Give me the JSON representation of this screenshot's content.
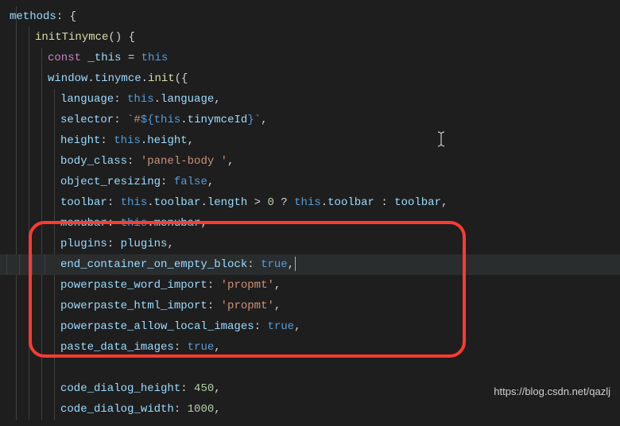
{
  "code": {
    "l1_a": "methods",
    "l1_b": ": {",
    "l2_a": "initTinymce",
    "l2_b": "() {",
    "l3_a": "const",
    "l3_b": " _this ",
    "l3_c": "=",
    "l3_d": " this",
    "l4_a": "window",
    "l4_b": ".",
    "l4_c": "tinymce",
    "l4_d": ".",
    "l4_e": "init",
    "l4_f": "({",
    "l5_k": "language",
    "l5_a": ": ",
    "l5_b": "this",
    "l5_c": ".",
    "l5_d": "language",
    "l5_e": ",",
    "l6_k": "selector",
    "l6_a": ": ",
    "l6_b": "`#",
    "l6_c": "${",
    "l6_d": "this",
    "l6_e": ".",
    "l6_f": "tinymceId",
    "l6_g": "}",
    "l6_h": "`",
    "l6_i": ",",
    "l7_k": "height",
    "l7_a": ": ",
    "l7_b": "this",
    "l7_c": ".",
    "l7_d": "height",
    "l7_e": ",",
    "l8_k": "body_class",
    "l8_a": ": ",
    "l8_b": "'panel-body '",
    "l8_c": ",",
    "l9_k": "object_resizing",
    "l9_a": ": ",
    "l9_b": "false",
    "l9_c": ",",
    "l10_k": "toolbar",
    "l10_a": ": ",
    "l10_b": "this",
    "l10_c": ".",
    "l10_d": "toolbar",
    "l10_e": ".",
    "l10_f": "length",
    "l10_g": " > ",
    "l10_h": "0",
    "l10_i": " ? ",
    "l10_j": "this",
    "l10_k2": ".",
    "l10_l": "toolbar",
    "l10_m": " : ",
    "l10_n": "toolbar",
    "l10_o": ",",
    "l11_k": "menubar",
    "l11_a": ": ",
    "l11_b": "this",
    "l11_c": ".",
    "l11_d": "menubar",
    "l11_e": ",",
    "l12_k": "plugins",
    "l12_a": ": ",
    "l12_b": "plugins",
    "l12_c": ",",
    "l13_k": "end_container_on_empty_block",
    "l13_a": ": ",
    "l13_b": "true",
    "l13_c": ",",
    "l14_k": "powerpaste_word_import",
    "l14_a": ": ",
    "l14_b": "'propmt'",
    "l14_c": ",",
    "l15_k": "powerpaste_html_import",
    "l15_a": ": ",
    "l15_b": "'propmt'",
    "l15_c": ",",
    "l16_k": "powerpaste_allow_local_images",
    "l16_a": ": ",
    "l16_b": "true",
    "l16_c": ",",
    "l17_k": "paste_data_images",
    "l17_a": ": ",
    "l17_b": "true",
    "l17_c": ",",
    "l18_k": "code_dialog_height",
    "l18_a": ": ",
    "l18_b": "450",
    "l18_c": ",",
    "l19_k": "code_dialog_width",
    "l19_a": ": ",
    "l19_b": "1000",
    "l19_c": ","
  },
  "watermark": "https://blog.csdn.net/qazlj"
}
